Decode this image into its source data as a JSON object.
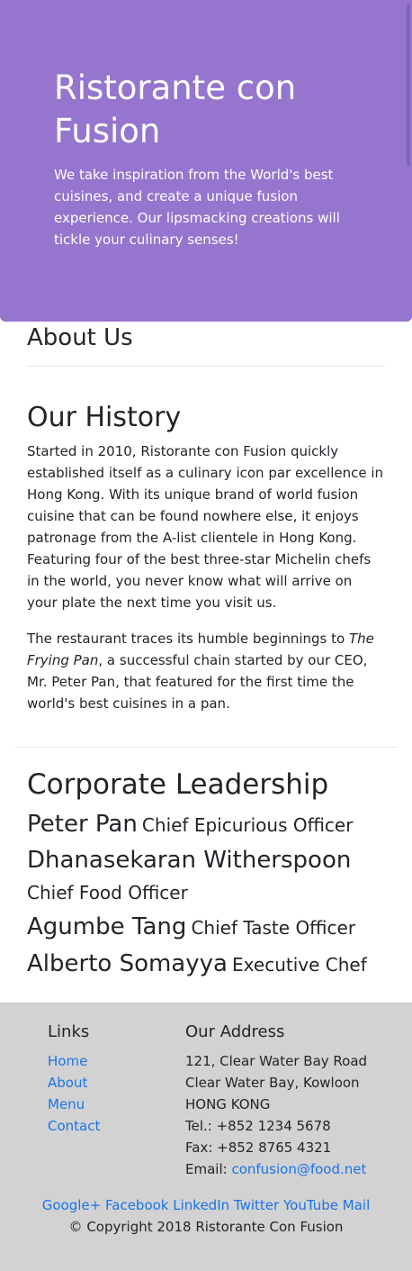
{
  "jumbotron": {
    "title_line1": "Ristorante con",
    "title_line2": "Fusion",
    "description": "We take inspiration from the World's best cuisines, and create a unique fusion experience. Our lipsmacking creations will tickle your culinary senses!"
  },
  "about": {
    "title": "About Us"
  },
  "history": {
    "title": "Our History",
    "para1": "Started in 2010, Ristorante con Fusion quickly established itself as a culinary icon par excellence in Hong Kong. With its unique brand of world fusion cuisine that can be found nowhere else, it enjoys patronage from the A-list clientele in Hong Kong. Featuring four of the best three-star Michelin chefs in the world, you never know what will arrive on your plate the next time you visit us.",
    "para2_before": "The restaurant traces its humble beginnings to ",
    "para2_italic": "The Frying Pan",
    "para2_after": ", a successful chain started by our CEO, Mr. Peter Pan, that featured for the first time the world's best cuisines in a pan."
  },
  "leadership": {
    "title": "Corporate Leadership",
    "leaders": [
      {
        "name": "Peter Pan",
        "role": "Chief Epicurious Officer"
      },
      {
        "name": "Dhanasekaran Witherspoon",
        "role": "Chief Food Officer"
      },
      {
        "name": "Agumbe Tang",
        "role": "Chief Taste Officer"
      },
      {
        "name": "Alberto Somayya",
        "role": "Executive Chef"
      }
    ]
  },
  "footer": {
    "links_title": "Links",
    "links": [
      "Home",
      "About",
      "Menu",
      "Contact"
    ],
    "address_title": "Our Address",
    "address_line1": "121, Clear Water Bay Road",
    "address_line2": "Clear Water Bay, Kowloon",
    "address_line3": "HONG KONG",
    "tel": "Tel.: +852 1234 5678",
    "fax": "Fax: +852 8765 4321",
    "email_label": "Email: ",
    "email": "confusion@food.net",
    "social": [
      "Google+",
      "Facebook",
      "LinkedIn",
      "Twitter",
      "YouTube",
      "Mail"
    ],
    "copyright": "© Copyright 2018 Ristorante Con Fusion"
  },
  "colors": {
    "jumbotron_bg": "#9575cd",
    "footer_bg": "#d2d2d2",
    "link": "#1a73e8"
  }
}
